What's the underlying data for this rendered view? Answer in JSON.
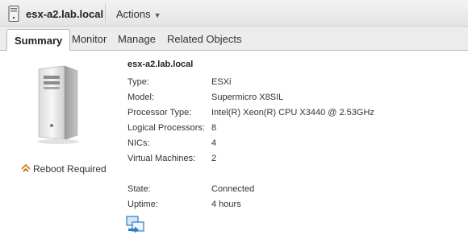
{
  "header": {
    "host_name": "esx-a2.lab.local",
    "actions_label": "Actions"
  },
  "tabs": [
    {
      "label": "Summary",
      "active": true
    },
    {
      "label": "Monitor",
      "active": false
    },
    {
      "label": "Manage",
      "active": false
    },
    {
      "label": "Related Objects",
      "active": false
    }
  ],
  "summary": {
    "title": "esx-a2.lab.local",
    "reboot_label": "Reboot Required",
    "fields": [
      {
        "label": "Type:",
        "value": "ESXi"
      },
      {
        "label": "Model:",
        "value": "Supermicro X8SIL"
      },
      {
        "label": "Processor Type:",
        "value": "Intel(R) Xeon(R) CPU X3440 @ 2.53GHz"
      },
      {
        "label": "Logical Processors:",
        "value": "8"
      },
      {
        "label": "NICs:",
        "value": "4"
      },
      {
        "label": "Virtual Machines:",
        "value": "2"
      },
      {
        "label": "State:",
        "value": "Connected"
      },
      {
        "label": "Uptime:",
        "value": "4 hours"
      }
    ]
  },
  "icons": {
    "host": "host-server-icon",
    "reboot": "reboot-warning-icon",
    "migrate": "migrate-vm-icon",
    "server_image": "server-tower-image"
  },
  "colors": {
    "accent_blue": "#2a7fc4",
    "warning_orange": "#e0891e"
  }
}
